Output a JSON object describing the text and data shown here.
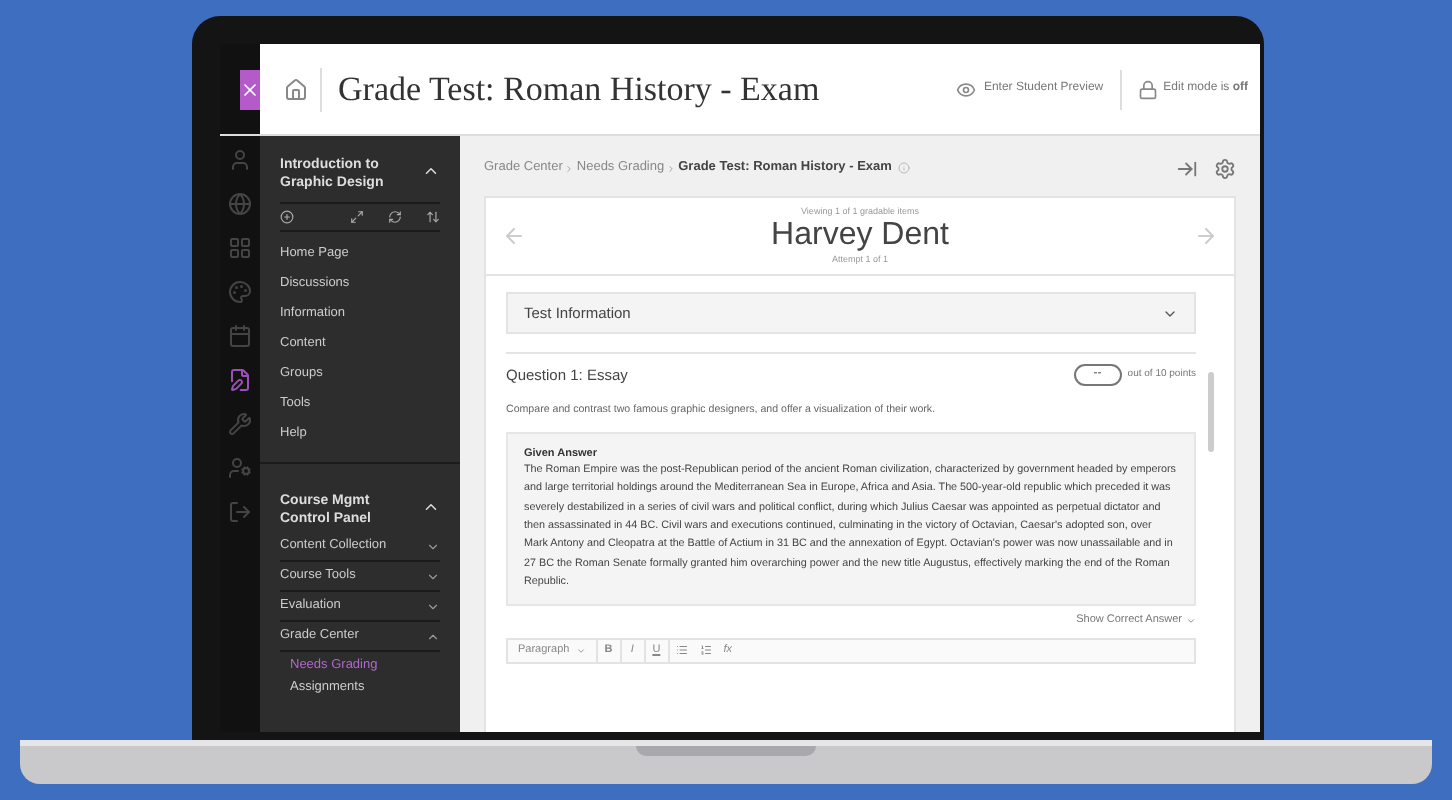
{
  "header": {
    "title": "Grade Test: Roman History - Exam",
    "preview_link": "Enter Student Preview",
    "edit_mode": "Edit mode is **off**"
  },
  "rail": [
    {
      "selected": false
    },
    {
      "selected": false
    },
    {
      "selected": false
    },
    {
      "selected": false
    },
    {
      "selected": false
    },
    {
      "selected": true
    },
    {
      "selected": false
    },
    {
      "selected": false
    },
    {
      "selected": false
    }
  ],
  "course_menu": {
    "title": "Introduction to Graphic Design",
    "expanded": true,
    "items": [
      "Home Page",
      "Discussions",
      "Information",
      "Content",
      "Groups",
      "Tools",
      "Help"
    ]
  },
  "control_panel": {
    "title": "Course Mgmt Control Panel",
    "expanded": true,
    "sections": [
      {
        "label": "Content Collection",
        "expanded": false
      },
      {
        "label": "Course Tools",
        "expanded": false
      },
      {
        "label": "Evaluation",
        "expanded": false
      },
      {
        "label": "Grade Center",
        "expanded": true,
        "children": [
          {
            "label": "Needs Grading",
            "selected": true
          },
          {
            "label": "Assignments",
            "selected": false
          }
        ]
      }
    ]
  },
  "breadcrumb": [
    {
      "label": "Grade Center",
      "current": false
    },
    {
      "label": "Needs Grading",
      "current": false
    },
    {
      "label": "Grade Test: Roman History - Exam",
      "current": true
    }
  ],
  "student": {
    "viewing": "Viewing 1 of 1 gradable items",
    "name": "Harvey Dent",
    "attempt": "Attempt 1 of 1"
  },
  "test_information": {
    "label": "Test Information",
    "expanded": false
  },
  "question": {
    "title": "Question 1: Essay",
    "score": "--",
    "points": "out of 10 points",
    "prompt": "Compare and contrast two famous graphic designers, and offer a visualization of their work.",
    "answer_heading": "Given Answer",
    "answer": "The Roman Empire was the post-Republican period of the ancient Roman civilization, characterized by government headed by emperors and large territorial holdings around the Mediterranean Sea in Europe, Africa and Asia. The 500-year-old republic which preceded it was severely destabilized in a series of civil wars and political conflict, during which Julius Caesar was appointed as perpetual dictator and then assassinated in 44 BC. Civil wars and executions continued, culminating in the victory of Octavian, Caesar's adopted son, over Mark Antony and Cleopatra at the Battle of Actium in 31 BC and the annexation of Egypt. Octavian's power was now unassailable and in 27 BC the Roman Senate formally granted him overarching power and the new title Augustus, effectively marking the end of the Roman Republic.",
    "show_correct": "Show Correct Answer"
  },
  "editor_toolbar": {
    "format": "Paragraph",
    "style_buttons": [
      "B",
      "I",
      "U"
    ],
    "formula": "fx"
  }
}
